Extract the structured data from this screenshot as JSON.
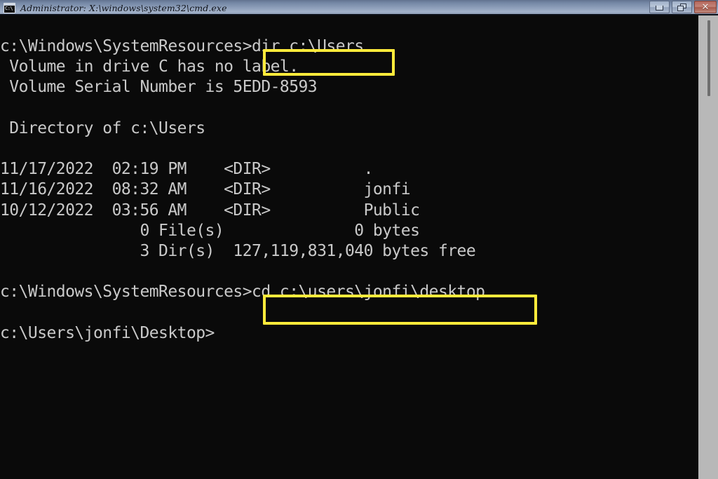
{
  "window": {
    "title": "Administrator: X:\\windows\\system32\\cmd.exe",
    "icon_name": "cmd-console-icon",
    "icon_glyph": "C:\\",
    "background_color": "#0a0a0a",
    "text_color": "#c9c9c9",
    "titlebar_accent": "#8fa0bb"
  },
  "controls": {
    "minimize_label": "Minimize",
    "restore_label": "Restore",
    "close_label": "Close",
    "close_glyph": "✕",
    "close_color": "#b4675c"
  },
  "terminal": {
    "lines": [
      "c:\\Windows\\SystemResources>dir c:\\Users",
      " Volume in drive C has no label.",
      " Volume Serial Number is 5EDD-8593",
      "",
      " Directory of c:\\Users",
      "",
      "11/17/2022  02:19 PM    <DIR>          .",
      "11/16/2022  08:32 AM    <DIR>          jonfi",
      "10/12/2022  03:56 AM    <DIR>          Public",
      "               0 File(s)              0 bytes",
      "               3 Dir(s)  127,119,831,040 bytes free",
      "",
      "c:\\Windows\\SystemResources>cd c:\\users\\jonfi\\desktop",
      "",
      "c:\\Users\\jonfi\\Desktop>"
    ],
    "prompt_current": "c:\\Users\\jonfi\\Desktop>",
    "volume_label": "no label",
    "volume_serial": "5EDD-8593",
    "directory_path": "c:\\Users",
    "entries": [
      {
        "date": "11/17/2022",
        "time": "02:19 PM",
        "type": "<DIR>",
        "name": "."
      },
      {
        "date": "11/16/2022",
        "time": "08:32 AM",
        "type": "<DIR>",
        "name": "jonfi"
      },
      {
        "date": "10/12/2022",
        "time": "03:56 AM",
        "type": "<DIR>",
        "name": "Public"
      }
    ],
    "file_count": "0 File(s)",
    "file_bytes": "0 bytes",
    "dir_count": "3 Dir(s)",
    "free_bytes": "127,119,831,040 bytes free"
  },
  "highlights": [
    {
      "label": "dir c:\\Users",
      "color": "#ffeb3b"
    },
    {
      "label": "cd c:\\users\\jonfi\\desktop",
      "color": "#ffeb3b"
    }
  ],
  "scrollbar": {
    "track_color": "#b8b8b8",
    "thumb_color": "#6e6e6e"
  }
}
